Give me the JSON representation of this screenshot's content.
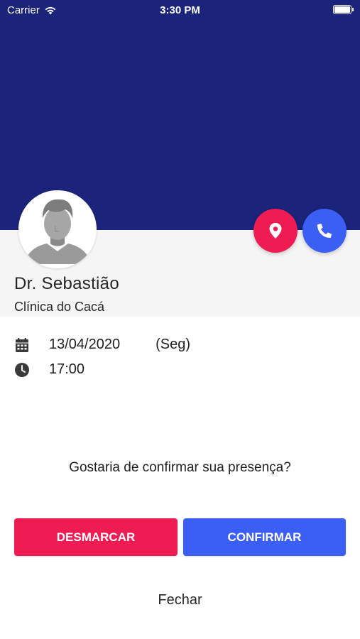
{
  "status_bar": {
    "carrier": "Carrier",
    "time": "3:30 PM"
  },
  "colors": {
    "header_bg": "#1b237b",
    "accent_red": "#ef1c54",
    "accent_blue": "#3b5ff5"
  },
  "doctor": {
    "name": "Dr. Sebastião",
    "clinic": "Clínica do Cacá",
    "avatar_icon": "person-silhouette-icon"
  },
  "actions": {
    "location_icon": "location-pin-icon",
    "phone_icon": "phone-icon"
  },
  "appointment": {
    "date": "13/04/2020",
    "weekday": "(Seg)",
    "time": "17:00",
    "date_icon": "calendar-icon",
    "time_icon": "clock-icon"
  },
  "prompt": {
    "question": "Gostaria de confirmar sua presença?"
  },
  "buttons": {
    "cancel_label": "DESMARCAR",
    "confirm_label": "CONFIRMAR",
    "close_label": "Fechar"
  }
}
